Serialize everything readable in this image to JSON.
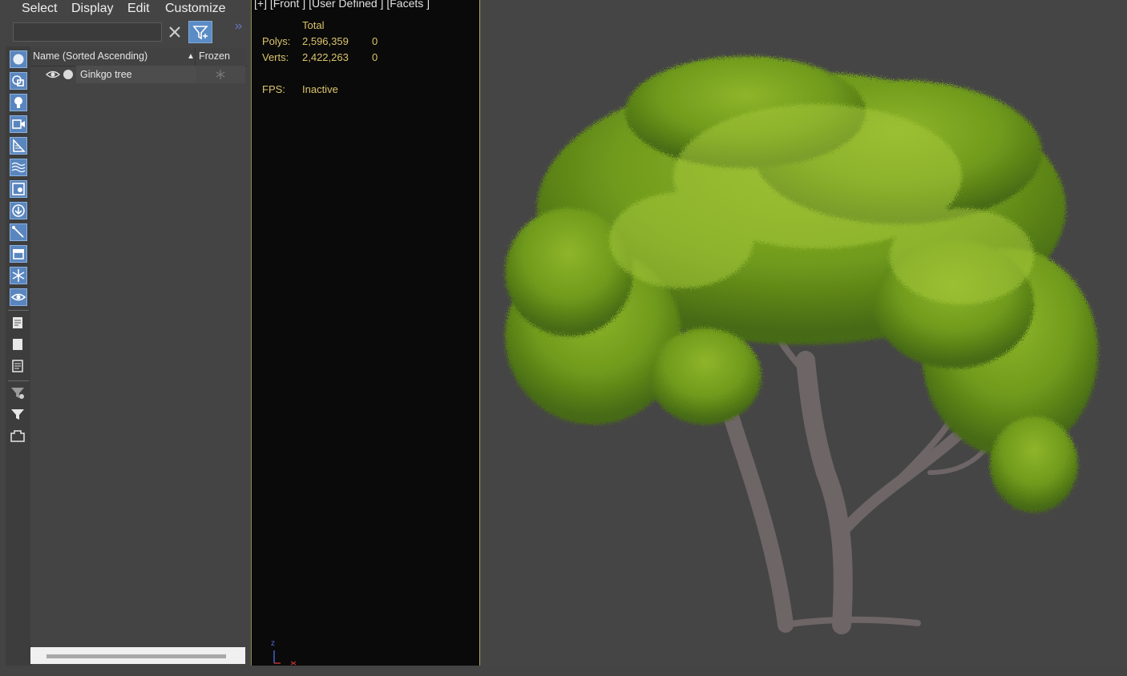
{
  "menu": {
    "items": [
      "Select",
      "Display",
      "Edit",
      "Customize"
    ]
  },
  "search": {
    "value": "",
    "placeholder": ""
  },
  "toolbar": {
    "clear_icon": "close-icon",
    "filter_icon": "filter-icon",
    "expand_icon": "double-chevron-right-icon"
  },
  "icon_strip": {
    "icons": [
      "geometry-icon",
      "shapes-icon",
      "lights-icon",
      "cameras-icon",
      "helpers-icon",
      "space-warps-icon",
      "groups-icon",
      "xrefs-icon",
      "bones-icon",
      "containers-icon",
      "frozen-icon",
      "hidden-icon",
      "document-icon",
      "blank-icon",
      "notes-icon",
      "filter-settings-icon",
      "filter-icon",
      "layer-icon"
    ]
  },
  "list": {
    "columns": {
      "name": "Name (Sorted Ascending)",
      "sort_glyph": "▲",
      "frozen": "Frozen"
    },
    "rows": [
      {
        "name": "Ginkgo tree",
        "visible": true,
        "frozen": false
      }
    ]
  },
  "viewport": {
    "label": "[+] [Front ] [User Defined ] [Facets ]",
    "stats": {
      "total_label": "Total",
      "polys_label": "Polys:",
      "polys_total": "2,596,359",
      "polys_selected": "0",
      "verts_label": "Verts:",
      "verts_total": "2,422,263",
      "verts_selected": "0",
      "fps_label": "FPS:",
      "fps_value": "Inactive"
    },
    "gizmo": {
      "z_label": "z"
    },
    "border_color": "#b5ad5a",
    "stats_color": "#dcc46a"
  },
  "colors": {
    "panel_bg": "#444444",
    "accent_blue": "#5b8cc5",
    "foliage": "#7fa61f",
    "trunk": "#6e6567"
  }
}
